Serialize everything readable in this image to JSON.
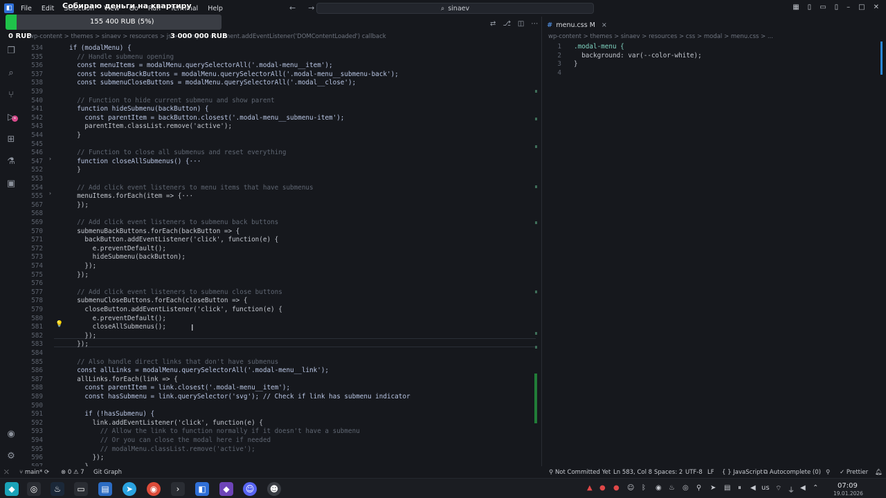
{
  "menubar": [
    "File",
    "Edit",
    "Selection",
    "View",
    "Go",
    "Run",
    "Terminal",
    "Help"
  ],
  "search": {
    "text": "sinaev"
  },
  "overlay": {
    "title": "Собираю деньги на квартиру",
    "current": "155 400 RUB (5%)",
    "progress_fraction": 0.05,
    "min": "0 RUB",
    "max": "3 000 000 RUB"
  },
  "left_editor": {
    "breadcrumb": "wp-content > themes > sinaev > resources > js > main.js > document.addEventListener('DOMContentLoaded') callback",
    "lines": [
      {
        "n": "534",
        "text": "if (modalMenu) {"
      },
      {
        "n": "535",
        "text": "  // Handle submenu opening"
      },
      {
        "n": "536",
        "text": "  const menuItems = modalMenu.querySelectorAll('.modal-menu__item');"
      },
      {
        "n": "537",
        "text": "  const submenuBackButtons = modalMenu.querySelectorAll('.modal-menu__submenu-back');"
      },
      {
        "n": "538",
        "text": "  const submenuCloseButtons = modalMenu.querySelectorAll('.modal__close');"
      },
      {
        "n": "539",
        "text": ""
      },
      {
        "n": "540",
        "text": "  // Function to hide current submenu and show parent"
      },
      {
        "n": "541",
        "text": "  function hideSubmenu(backButton) {"
      },
      {
        "n": "542",
        "text": "    const parentItem = backButton.closest('.modal-menu__submenu-item');"
      },
      {
        "n": "543",
        "text": "    parentItem.classList.remove('active');"
      },
      {
        "n": "544",
        "text": "  }"
      },
      {
        "n": "545",
        "text": ""
      },
      {
        "n": "546",
        "text": "  // Function to close all submenus and reset everything"
      },
      {
        "n": "547",
        "text": "  function closeAllSubmenus() {···"
      },
      {
        "n": "552",
        "text": "  }"
      },
      {
        "n": "553",
        "text": ""
      },
      {
        "n": "554",
        "text": "  // Add click event listeners to menu items that have submenus"
      },
      {
        "n": "555",
        "text": "  menuItems.forEach(item => {···"
      },
      {
        "n": "567",
        "text": "  });"
      },
      {
        "n": "568",
        "text": ""
      },
      {
        "n": "569",
        "text": "  // Add click event listeners to submenu back buttons"
      },
      {
        "n": "570",
        "text": "  submenuBackButtons.forEach(backButton => {"
      },
      {
        "n": "571",
        "text": "    backButton.addEventListener('click', function(e) {"
      },
      {
        "n": "572",
        "text": "      e.preventDefault();"
      },
      {
        "n": "573",
        "text": "      hideSubmenu(backButton);"
      },
      {
        "n": "574",
        "text": "    });"
      },
      {
        "n": "575",
        "text": "  });"
      },
      {
        "n": "576",
        "text": ""
      },
      {
        "n": "577",
        "text": "  // Add click event listeners to submenu close buttons"
      },
      {
        "n": "578",
        "text": "  submenuCloseButtons.forEach(closeButton => {"
      },
      {
        "n": "579",
        "text": "    closeButton.addEventListener('click', function(e) {"
      },
      {
        "n": "580",
        "text": "      e.preventDefault();"
      },
      {
        "n": "581",
        "text": "      closeAllSubmenus();"
      },
      {
        "n": "582",
        "text": "    });"
      },
      {
        "n": "583",
        "text": "  });"
      },
      {
        "n": "584",
        "text": ""
      },
      {
        "n": "585",
        "text": "  // Also handle direct links that don't have submenus"
      },
      {
        "n": "586",
        "text": "  const allLinks = modalMenu.querySelectorAll('.modal-menu__link');"
      },
      {
        "n": "587",
        "text": "  allLinks.forEach(link => {"
      },
      {
        "n": "588",
        "text": "    const parentItem = link.closest('.modal-menu__item');"
      },
      {
        "n": "589",
        "text": "    const hasSubmenu = link.querySelector('svg'); // Check if link has submenu indicator"
      },
      {
        "n": "590",
        "text": ""
      },
      {
        "n": "591",
        "text": "    if (!hasSubmenu) {"
      },
      {
        "n": "592",
        "text": "      link.addEventListener('click', function(e) {"
      },
      {
        "n": "593",
        "text": "        // Allow the link to function normally if it doesn't have a submenu"
      },
      {
        "n": "594",
        "text": "        // Or you can close the modal here if needed"
      },
      {
        "n": "595",
        "text": "        // modalMenu.classList.remove('active');"
      },
      {
        "n": "596",
        "text": "      });"
      },
      {
        "n": "597",
        "text": "    }"
      }
    ]
  },
  "right_editor": {
    "tab_label": "menu.css M",
    "breadcrumb": "wp-content > themes > sinaev > resources > css > modal > menu.css > ...",
    "lines": [
      {
        "n": "1",
        "text": ".modal-menu {"
      },
      {
        "n": "2",
        "text": "  background: var(--color-white);"
      },
      {
        "n": "3",
        "text": "}"
      },
      {
        "n": "4",
        "text": ""
      }
    ]
  },
  "statusbar": {
    "branch": "main*",
    "problems": "0 ⚠ 7",
    "git_graph": "Git Graph",
    "blame": "Not Committed Yet",
    "position": "Ln 583, Col 8",
    "spaces": "Spaces: 2",
    "encoding": "UTF-8",
    "eol": "LF",
    "language": "JavaScript",
    "autocomplete": "Autocomplete (0)",
    "prettier": "Prettier"
  },
  "taskbar": {
    "time": "07:09",
    "date": "19.01.2026",
    "keyboard": "us"
  },
  "colors": {
    "keyword": "#c678dd",
    "string": "#e8c16a",
    "comment": "#5f6672",
    "func": "#7fb2ff",
    "param": "#e59c6b",
    "progress": "#1fc24a"
  }
}
